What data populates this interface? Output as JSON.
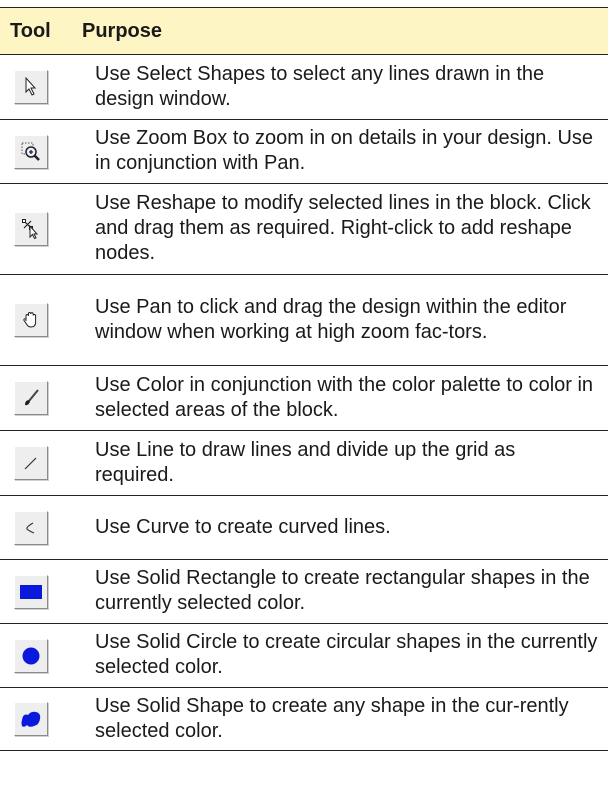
{
  "table": {
    "headers": {
      "tool": "Tool",
      "purpose": "Purpose"
    },
    "rows": [
      {
        "icon": "select-arrow-icon",
        "text": "Use Select Shapes to select any lines drawn in the design window."
      },
      {
        "icon": "zoom-box-icon",
        "text": "Use Zoom Box to zoom in on details in your design. Use in conjunction with Pan."
      },
      {
        "icon": "reshape-icon",
        "text": "Use Reshape to modify selected lines in the block. Click and drag them as required. Right-click to add reshape nodes."
      },
      {
        "icon": "pan-hand-icon",
        "text": "Use Pan to click and drag the design within the editor window when working at high zoom fac-tors."
      },
      {
        "icon": "color-brush-icon",
        "text": "Use Color in conjunction with the color palette to color in selected areas of the block."
      },
      {
        "icon": "line-icon",
        "text": "Use Line to draw lines and divide up the grid as required."
      },
      {
        "icon": "curve-icon",
        "text": "Use Curve to create curved lines."
      },
      {
        "icon": "solid-rectangle-icon",
        "text": "Use Solid Rectangle to create rectangular shapes in the currently selected color."
      },
      {
        "icon": "solid-circle-icon",
        "text": "Use Solid Circle to create circular shapes in the currently selected color."
      },
      {
        "icon": "solid-shape-icon",
        "text": "Use Solid Shape to create any shape in the cur-rently selected color."
      }
    ]
  },
  "colors": {
    "header_bg": "#fdf6c4",
    "shape_fill": "#0a1adc"
  }
}
